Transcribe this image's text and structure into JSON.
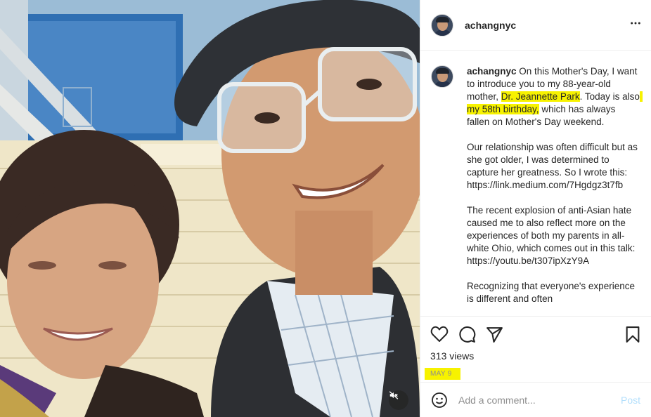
{
  "post": {
    "username": "achangnyc",
    "more_icon": "more-horizontal-icon"
  },
  "caption": {
    "username": "achangnyc",
    "segments": [
      " On this Mother's Day, I want to introduce you to my 88-year-old mother, ",
      "Dr. Jeannette Park",
      ". Today is also",
      " my 58th birthday,",
      " which has always fallen on Mother's Day weekend.\n\nOur relationship was often difficult but as she got older, I was determined to capture her greatness. So I wrote this: https://link.medium.com/7Hgdgz3t7fb\n\nThe recent explosion of anti-Asian hate caused me to also reflect more on the experiences of both my parents in all-white Ohio, which comes out in this talk: https://youtu.be/t307ipXzY9A\n\nRecognizing that everyone's experience is different and often"
    ],
    "highlight_color": "#f7f200"
  },
  "actions": {
    "like_icon": "heart-icon",
    "comment_icon": "comment-icon",
    "share_icon": "paper-plane-icon",
    "save_icon": "bookmark-icon",
    "views": "313 views",
    "date": "MAY 9"
  },
  "comment_box": {
    "emoji_icon": "smiley-icon",
    "placeholder": "Add a comment...",
    "post_label": "Post",
    "post_color": "#b2dffc"
  },
  "media": {
    "mute_icon": "speaker-muted-icon"
  }
}
